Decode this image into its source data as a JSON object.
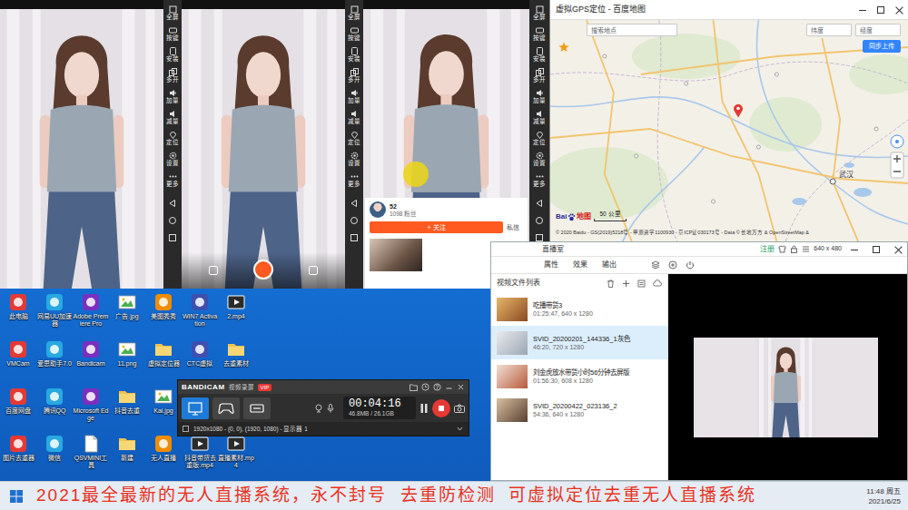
{
  "emulator_sidebar": [
    {
      "label": "全屏"
    },
    {
      "label": "按键"
    },
    {
      "label": "安装"
    },
    {
      "label": "多开"
    },
    {
      "label": "加量"
    },
    {
      "label": "减量"
    },
    {
      "label": "定位"
    },
    {
      "label": "设置"
    },
    {
      "label": "更多"
    }
  ],
  "emulators": [
    {
      "kind": "live"
    },
    {
      "kind": "camera"
    },
    {
      "kind": "profile",
      "profile": {
        "name": "52",
        "fans": "1098 粉丝",
        "follow": "+ 关注",
        "message": "私信"
      }
    }
  ],
  "map_window": {
    "title": "虚拟GPS定位 - 百度地图",
    "search": {
      "placeholder": "搜索地点"
    },
    "lat": {
      "placeholder": "纬度"
    },
    "lng": {
      "placeholder": "经度"
    },
    "upload": "同步上传",
    "city": "武汉",
    "scale": "50 公里",
    "logo_left": "Bai",
    "logo_right": "地图",
    "copyright": "© 2020 Baidu - GS(2019)5218号 - 甲测资字1100930 - 京ICP证030173号 - Data © 长地万方 & OpenStreetMap &"
  },
  "live_window": {
    "title": "直播室",
    "register": "注册",
    "resolution": "640 x 480",
    "tabs": [
      {
        "label": "属性"
      },
      {
        "label": "效果"
      },
      {
        "label": "输出"
      }
    ],
    "list_title": "视频文件列表",
    "videos": [
      {
        "name": "吃播带货3",
        "meta": "01:25:47, 640 x 1280",
        "selected": false
      },
      {
        "name": "SVID_20200201_144336_1灰色",
        "meta": "46:20, 720 x 1280",
        "selected": true
      },
      {
        "name": "刘金虎放水带货小时56分钟去屏版",
        "meta": "01:56:30, 608 x 1280",
        "selected": false
      },
      {
        "name": "SVID_20200422_023136_2",
        "meta": "54:36, 640 x 1280",
        "selected": false
      }
    ]
  },
  "desktop_icons": [
    [
      {
        "label": "此电脑",
        "kind": "app"
      },
      {
        "label": "网易UU加速器",
        "kind": "app"
      },
      {
        "label": "Adobe Premiere Pro",
        "kind": "app"
      },
      {
        "label": "广告.jpg",
        "kind": "image"
      },
      {
        "label": "美图秀秀",
        "kind": "app"
      },
      {
        "label": "WIN7 Activation",
        "kind": "app"
      },
      {
        "label": "2.mp4",
        "kind": "video"
      }
    ],
    [
      {
        "label": "VMCam",
        "kind": "app"
      },
      {
        "label": "爱思助手7.0",
        "kind": "app"
      },
      {
        "label": "Bandicam",
        "kind": "app"
      },
      {
        "label": "11.png",
        "kind": "image"
      },
      {
        "label": "虚拟定位器",
        "kind": "folder"
      },
      {
        "label": "CTC虚拟",
        "kind": "app"
      },
      {
        "label": "去重素材",
        "kind": "folder"
      }
    ],
    [
      {
        "label": "百度网盘",
        "kind": "app"
      },
      {
        "label": "腾讯QQ",
        "kind": "app"
      },
      {
        "label": "Microsoft Edge",
        "kind": "app"
      },
      {
        "label": "抖音去重",
        "kind": "folder"
      },
      {
        "label": "Kai.jpg",
        "kind": "image"
      }
    ],
    [
      {
        "label": "图片去重器",
        "kind": "app"
      },
      {
        "label": "微信",
        "kind": "app"
      },
      {
        "label": "QSVMINI工具",
        "kind": "file"
      },
      {
        "label": "新建",
        "kind": "folder"
      },
      {
        "label": "无人直播",
        "kind": "app"
      },
      {
        "label": "抖音带货去重版.mp4",
        "kind": "video"
      },
      {
        "label": "直播素材.mp4",
        "kind": "video"
      }
    ]
  ],
  "bandicam": {
    "logo": "BANDICAM",
    "subtitle": "视频录屏",
    "badge": "VIP",
    "modes": [
      {
        "kind": "screen",
        "selected": true
      },
      {
        "kind": "game",
        "selected": false
      },
      {
        "kind": "device",
        "selected": false
      }
    ],
    "time": "00:04:16",
    "size": "46.8MB / 26.1GB",
    "recording": true,
    "region_checked": false,
    "region": "1920x1080 - (0, 0), (1920, 1080) - 显示器 1"
  },
  "taskbar": {
    "caption": "2021最全最新的无人直播系统，永不封号  去重防检测  可虚拟定位去重无人直播系统",
    "time": "11:48 周五",
    "date": "2021/6/25"
  }
}
